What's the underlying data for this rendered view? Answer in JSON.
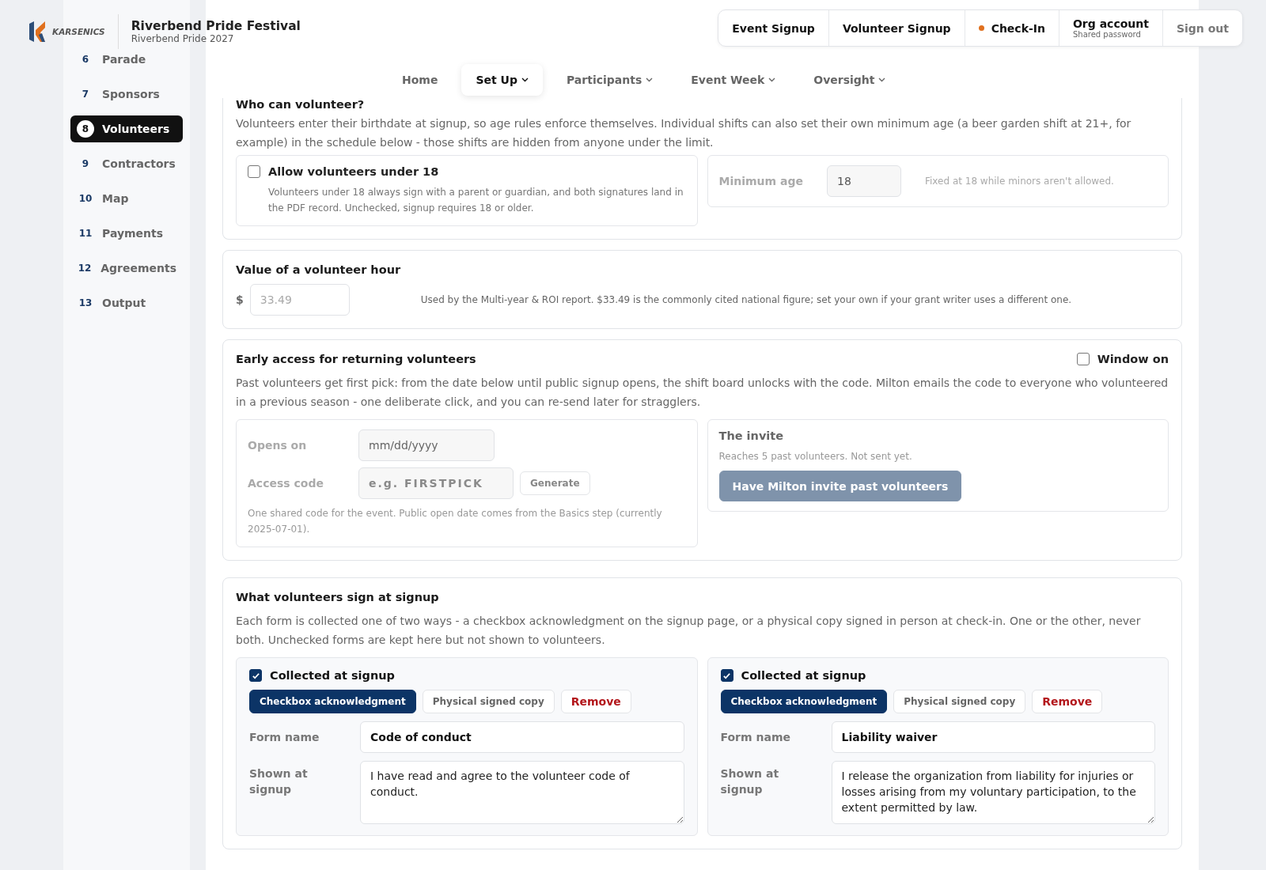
{
  "brand": {
    "logo": "KARSENICS",
    "title": "Riverbend Pride Festival",
    "subtitle": "Riverbend Pride 2027"
  },
  "top_actions": [
    {
      "kind": "link",
      "label": "Event Signup"
    },
    {
      "kind": "link",
      "label": "Volunteer Signup"
    },
    {
      "kind": "status",
      "label": "Check-In",
      "color": "#e0701e"
    },
    {
      "kind": "account",
      "label": "Org account",
      "sub": "Shared password"
    },
    {
      "kind": "muted",
      "label": "Sign out"
    }
  ],
  "nav": [
    {
      "label": "Home",
      "selected": false,
      "menu": false
    },
    {
      "label": "Set Up",
      "selected": true,
      "menu": true
    },
    {
      "label": "Participants",
      "selected": false,
      "menu": true
    },
    {
      "label": "Event Week",
      "selected": false,
      "menu": true
    },
    {
      "label": "Oversight",
      "selected": false,
      "menu": true
    }
  ],
  "sidebar": [
    {
      "number": "6",
      "label": "Parade",
      "selected": false
    },
    {
      "number": "7",
      "label": "Sponsors",
      "selected": false
    },
    {
      "number": "8",
      "label": "Volunteers",
      "selected": true
    },
    {
      "number": "9",
      "label": "Contractors",
      "selected": false
    },
    {
      "number": "10",
      "label": "Map",
      "selected": false
    },
    {
      "number": "11",
      "label": "Payments",
      "selected": false
    },
    {
      "number": "12",
      "label": "Agreements",
      "selected": false
    },
    {
      "number": "13",
      "label": "Output",
      "selected": false
    }
  ],
  "age": {
    "title": "Who can volunteer?",
    "text": "Volunteers enter their birthdate at signup, so age rules enforce themselves. Individual shifts can also set their own minimum age (a beer garden shift at 21+, for example) in the schedule below - those shifts are hidden from anyone under the limit.",
    "allow": {
      "label": "Allow volunteers under 18",
      "checked": false,
      "help": "Volunteers under 18 always sign with a parent or guardian, and both signatures land in the PDF record. Unchecked, signup requires 18 or older."
    },
    "min_label": "Minimum age",
    "min_value": "18",
    "min_note": "Fixed at 18 while minors aren't allowed."
  },
  "hour": {
    "title": "Value of a volunteer hour",
    "currency": "$",
    "placeholder": "33.49",
    "note": "Used by the Multi-year & ROI report. $33.49 is the commonly cited national figure; set your own if your grant writer uses a different one."
  },
  "early": {
    "title": "Early access for returning volunteers",
    "window": {
      "label": "Window on",
      "checked": false
    },
    "text": "Past volunteers get first pick: from the date below until public signup opens, the shift board unlocks with the code. Milton emails the code to everyone who volunteered in a previous season - one deliberate click, and you can re-send later for stragglers.",
    "opens_label": "Opens on",
    "opens_placeholder": "mm/dd/yyyy",
    "code_label": "Access code",
    "code_placeholder": "e.g. FIRSTPICK",
    "generate": "Generate",
    "code_note": "One shared code for the event. Public open date comes from the Basics step (currently 2025-07-01).",
    "invite_title": "The invite",
    "invite_note": "Reaches 5 past volunteers. Not sent yet.",
    "invite_button": "Have Milton invite past volunteers"
  },
  "forms": {
    "title": "What volunteers sign at signup",
    "text": "Each form is collected one of two ways - a checkbox acknowledgment on the signup page, or a physical copy signed in person at check-in. One or the other, never both. Unchecked forms are kept here but not shown to volunteers.",
    "items": [
      {
        "collected_label": "Collected at signup",
        "collected": true,
        "modes": [
          {
            "label": "Checkbox acknowledgment",
            "selected": true
          },
          {
            "label": "Physical signed copy",
            "selected": false
          }
        ],
        "remove": "Remove",
        "name_label": "Form name",
        "name": "Code of conduct",
        "shown_label": "Shown at signup",
        "shown": "I have read and agree to the volunteer code of conduct."
      },
      {
        "collected_label": "Collected at signup",
        "collected": true,
        "modes": [
          {
            "label": "Checkbox acknowledgment",
            "selected": true
          },
          {
            "label": "Physical signed copy",
            "selected": false
          }
        ],
        "remove": "Remove",
        "name_label": "Form name",
        "name": "Liability waiver",
        "shown_label": "Shown at signup",
        "shown": "I release the organization from liability for injuries or losses arising from my voluntary participation, to the extent permitted by law."
      }
    ]
  }
}
